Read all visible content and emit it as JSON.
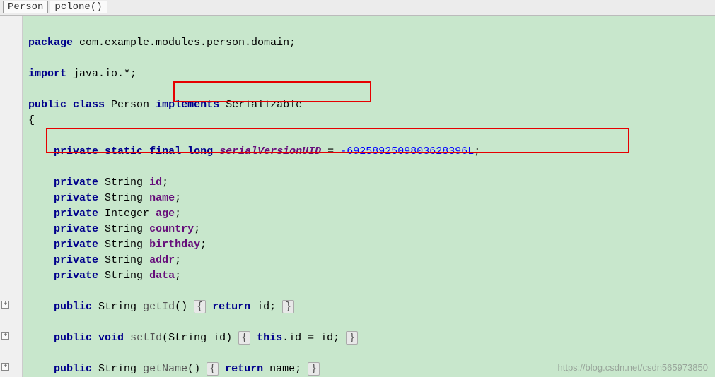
{
  "breadcrumb": {
    "class_name": "Person",
    "method_name": "pclone()"
  },
  "code": {
    "package_kw": "package",
    "package_name": " com.example.modules.person.domain;",
    "import_kw": "import",
    "import_name": " java.io.*;",
    "public_kw": "public",
    "class_kw": "class",
    "class_name": " Person ",
    "implements_kw": "implements",
    "serializable": " Serializable",
    "brace_open": "{",
    "private_kw": "private",
    "static_kw": "static",
    "final_kw": "final",
    "long_kw": "long",
    "svu_field": "serialVersionUID",
    "svu_eq": " = ",
    "svu_val": "-6925892509803628396L",
    "semi": ";",
    "string_type": "String",
    "integer_type": "Integer",
    "void_kw": "void",
    "this_kw": "this",
    "return_kw": "return",
    "fields": {
      "id": "id",
      "name": "name",
      "age": "age",
      "country": "country",
      "birthday": "birthday",
      "addr": "addr",
      "data": "data"
    },
    "getId": "getId",
    "setId": "setId",
    "getName": "getName",
    "getId_sig": "() ",
    "setId_sig": "(String id) ",
    "getName_sig": "() ",
    "fold_l": "{",
    "fold_r": "}",
    "getId_body": " id; ",
    "setId_body_a": ".id = id; ",
    "getName_body": " name; "
  },
  "fold_icons": {
    "plus": "+"
  },
  "watermark": "https://blog.csdn.net/csdn565973850"
}
